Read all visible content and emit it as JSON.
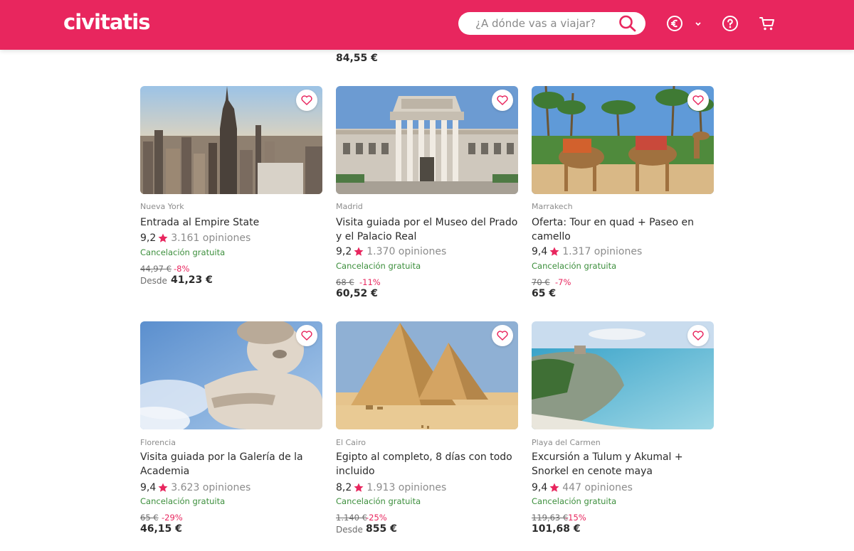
{
  "brand": {
    "name": "civitatis",
    "color": "#e8265e"
  },
  "header": {
    "search_placeholder": "¿A dónde vas a viajar?",
    "icons": [
      "euro-icon",
      "chevron-down-icon",
      "help-icon",
      "cart-icon"
    ]
  },
  "partial_row": {
    "price": "84,55 €"
  },
  "cards": [
    {
      "city": "Nueva York",
      "title": "Entrada al Empire State",
      "score": "9,2",
      "opinions": "3.161 opiniones",
      "free": "Cancelación gratuita",
      "old_price": "44,97 €",
      "discount": "-8%",
      "desde": "Desde",
      "price": "41,23 €"
    },
    {
      "city": "Madrid",
      "title": "Visita guiada por el Museo del Prado y el Palacio Real",
      "score": "9,2",
      "opinions": "1.370 opiniones",
      "free": "Cancelación gratuita",
      "old_price": "68 €",
      "discount": "-11%",
      "desde": "",
      "price": "60,52 €"
    },
    {
      "city": "Marrakech",
      "title": "Oferta: Tour en quad + Paseo en camello",
      "score": "9,4",
      "opinions": "1.317 opiniones",
      "free": "Cancelación gratuita",
      "old_price": "70 €",
      "discount": "-7%",
      "desde": "",
      "price": "65 €"
    },
    {
      "city": "Florencia",
      "title": "Visita guiada por la Galería de la Academia",
      "score": "9,4",
      "opinions": "3.623 opiniones",
      "free": "Cancelación gratuita",
      "old_price": "65 €",
      "discount": "-29%",
      "desde": "",
      "price": "46,15 €"
    },
    {
      "city": "El Cairo",
      "title": "Egipto al completo, 8 días con todo incluido",
      "score": "8,2",
      "opinions": "1.913 opiniones",
      "free": "Cancelación gratuita",
      "old_price": "1.140 €",
      "discount": "-25%",
      "desde": "Desde",
      "price": "855 €"
    },
    {
      "city": "Playa del Carmen",
      "title": "Excursión a Tulum y Akumal + Snorkel en cenote maya",
      "score": "9,4",
      "opinions": "447 opiniones",
      "free": "Cancelación gratuita",
      "old_price": "119,63 €",
      "discount": "-15%",
      "desde": "",
      "price": "101,68 €"
    }
  ]
}
